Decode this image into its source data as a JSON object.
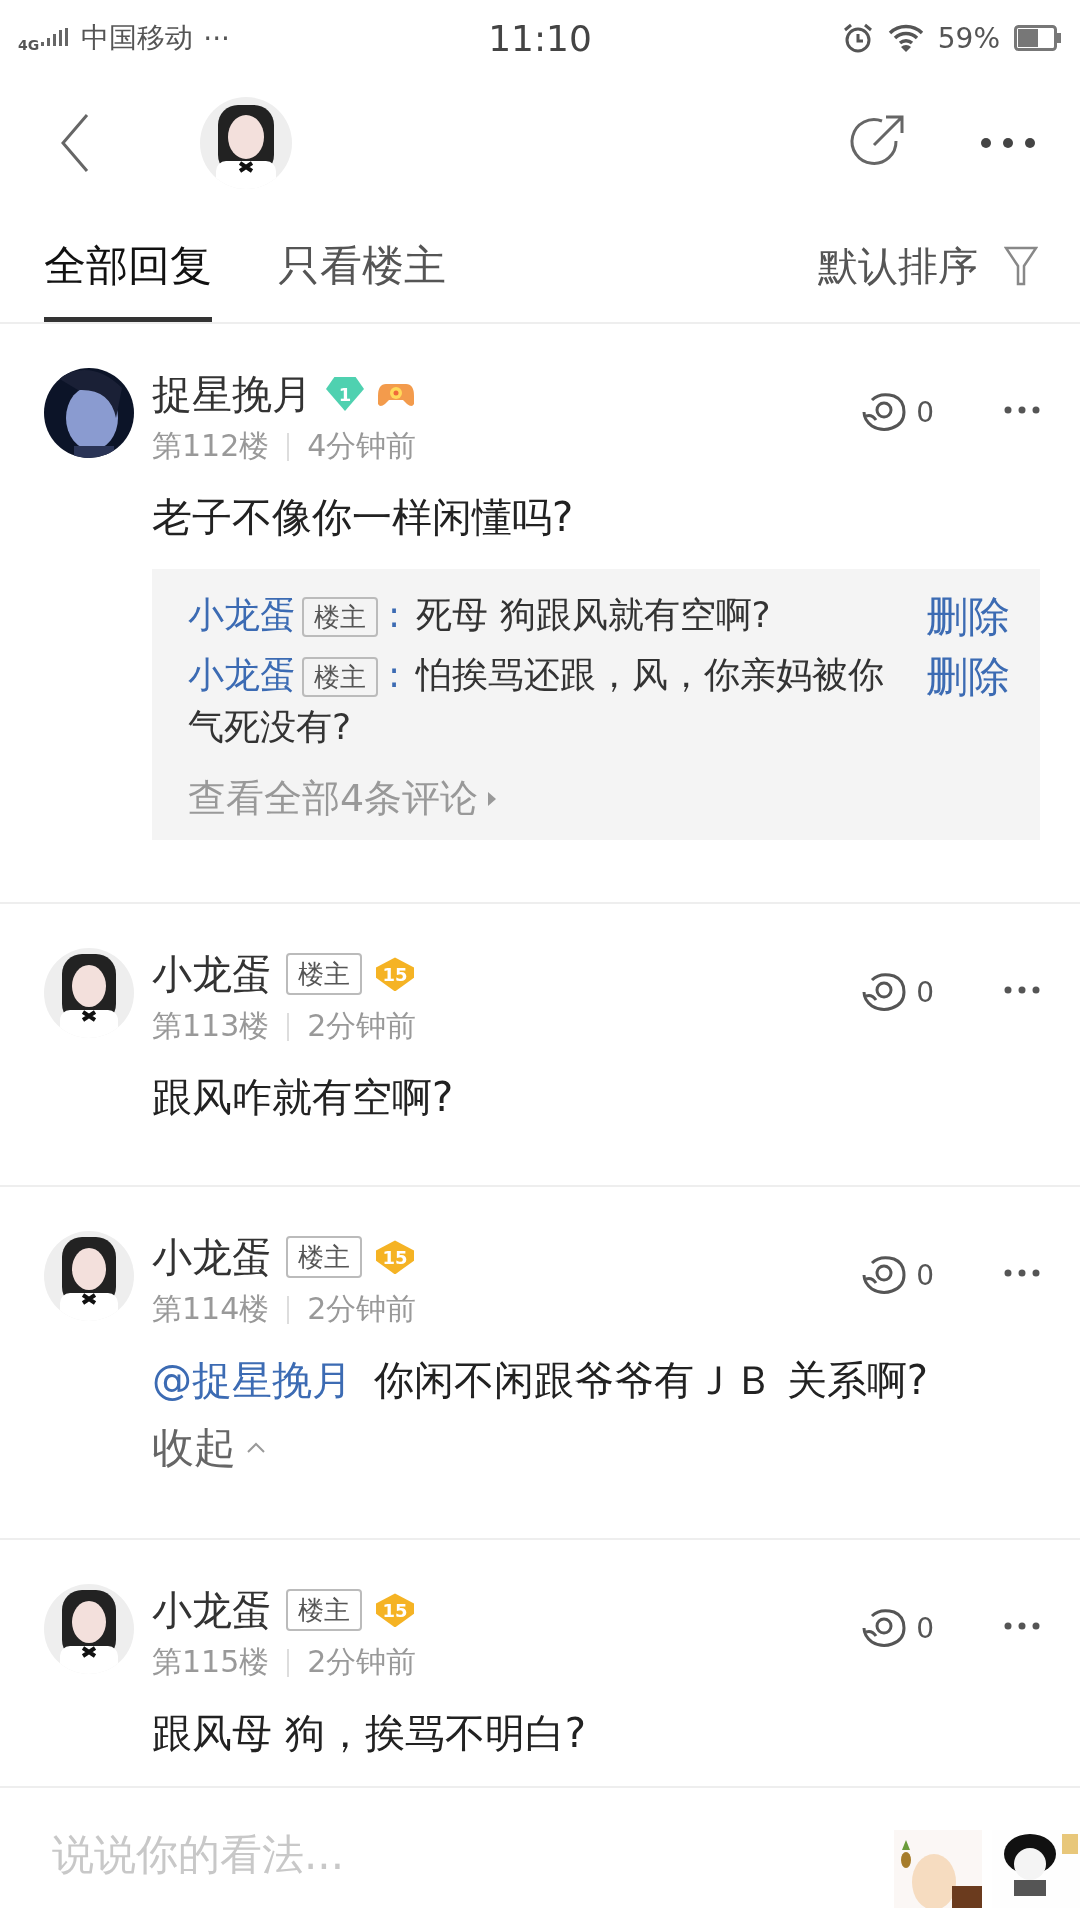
{
  "status_bar": {
    "network": "4G",
    "carrier": "中国移动",
    "more": "···",
    "time": "11:10",
    "battery_text": "59%"
  },
  "tabs": [
    {
      "label": "全部回复",
      "selected": true
    },
    {
      "label": "只看楼主",
      "selected": false
    }
  ],
  "sort": {
    "label": "默认排序"
  },
  "posts": [
    {
      "author": "捉星挽月",
      "badge": {
        "kind": "gem",
        "text": "1"
      },
      "game_badge": true,
      "floor": "第112楼",
      "time": "4分钟前",
      "likes": "0",
      "text": "老子不像你一样闲懂吗?",
      "replies": [
        {
          "author": "小龙蛋",
          "tag": "楼主",
          "separator": ":",
          "text": "死母 狗跟风就有空啊?",
          "action": "删除"
        },
        {
          "author": "小龙蛋",
          "tag": "楼主",
          "separator": ":",
          "text": "怕挨骂还跟，风，你亲妈被你气死没有?",
          "action": "删除"
        }
      ],
      "more_replies": "查看全部4条评论"
    },
    {
      "author": "小龙蛋",
      "op_tag": "楼主",
      "badge": {
        "kind": "shield",
        "text": "15"
      },
      "game_badge": false,
      "floor": "第113楼",
      "time": "2分钟前",
      "likes": "0",
      "text": "跟风咋就有空啊?"
    },
    {
      "author": "小龙蛋",
      "op_tag": "楼主",
      "badge": {
        "kind": "shield",
        "text": "15"
      },
      "game_badge": false,
      "floor": "第114楼",
      "time": "2分钟前",
      "likes": "0",
      "mention": "@捉星挽月",
      "text": "你闲不闲跟爷爷有ＪＢ 关系啊?",
      "collapse": "收起"
    },
    {
      "author": "小龙蛋",
      "op_tag": "楼主",
      "badge": {
        "kind": "shield",
        "text": "15"
      },
      "game_badge": false,
      "floor": "第115楼",
      "time": "2分钟前",
      "likes": "0",
      "text": "跟风母 狗，挨骂不明白?"
    }
  ],
  "input": {
    "placeholder": "说说你的看法..."
  }
}
